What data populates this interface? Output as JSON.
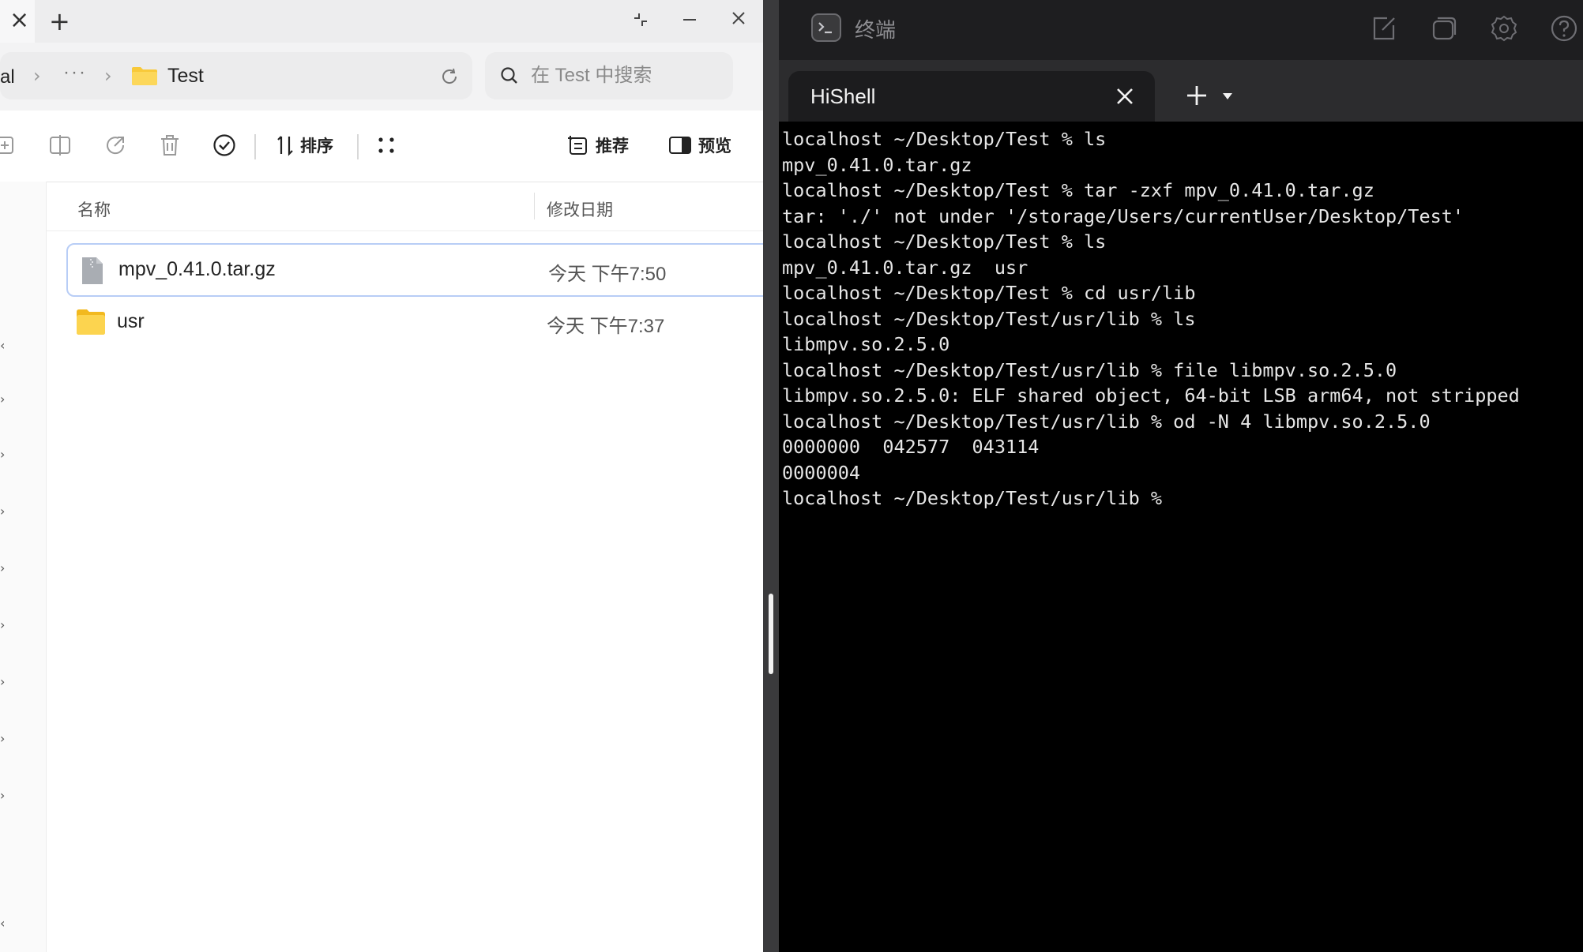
{
  "file_manager": {
    "tabbar": {
      "close_glyph": "×",
      "add_glyph": "+"
    },
    "breadcrumb": {
      "truncated_root": "al",
      "more": "···",
      "current": "Test"
    },
    "search": {
      "placeholder": "在 Test 中搜索"
    },
    "toolbar": {
      "sort_label": "排序",
      "recommend_label": "推荐",
      "preview_label": "预览"
    },
    "list": {
      "columns": {
        "name": "名称",
        "modified": "修改日期"
      },
      "rows": [
        {
          "name": "mpv_0.41.0.tar.gz",
          "date": "今天 下午7:50",
          "type": "archive"
        },
        {
          "name": "usr",
          "date": "今天 下午7:37",
          "type": "folder"
        }
      ]
    }
  },
  "terminal": {
    "app_title": "终端",
    "tab_label": "HiShell",
    "lines": [
      "localhost ~/Desktop/Test % ls",
      "mpv_0.41.0.tar.gz",
      "localhost ~/Desktop/Test % tar -zxf mpv_0.41.0.tar.gz",
      "tar: './' not under '/storage/Users/currentUser/Desktop/Test'",
      "localhost ~/Desktop/Test % ls",
      "mpv_0.41.0.tar.gz  usr",
      "localhost ~/Desktop/Test % cd usr/lib",
      "localhost ~/Desktop/Test/usr/lib % ls",
      "libmpv.so.2.5.0",
      "localhost ~/Desktop/Test/usr/lib % file libmpv.so.2.5.0",
      "libmpv.so.2.5.0: ELF shared object, 64-bit LSB arm64, not stripped",
      "localhost ~/Desktop/Test/usr/lib % od -N 4 libmpv.so.2.5.0",
      "0000000  042577  043114",
      "0000004",
      "localhost ~/Desktop/Test/usr/lib % "
    ]
  },
  "colors": {
    "selection_border": "#b8cdf6",
    "folder_yellow": "#f8c93a",
    "terminal_bg": "#000000"
  }
}
